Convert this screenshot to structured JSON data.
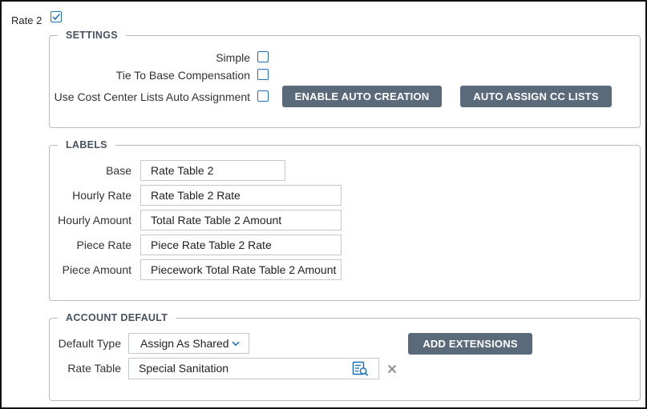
{
  "rate": {
    "label": "Rate 2",
    "enabled": true
  },
  "settings": {
    "title": "SETTINGS",
    "simple_label": "Simple",
    "tie_label": "Tie To Base Compensation",
    "cost_center_label": "Use Cost Center Lists Auto Assignment",
    "enable_button": "ENABLE AUTO CREATION",
    "assign_button": "AUTO ASSIGN CC LISTS"
  },
  "labels": {
    "title": "LABELS",
    "base_label": "Base",
    "base_value": "Rate Table 2",
    "hourly_rate_label": "Hourly Rate",
    "hourly_rate_value": "Rate Table 2 Rate",
    "hourly_amount_label": "Hourly Amount",
    "hourly_amount_value": "Total Rate Table 2 Amount",
    "piece_rate_label": "Piece Rate",
    "piece_rate_value": "Piece Rate Table 2 Rate",
    "piece_amount_label": "Piece Amount",
    "piece_amount_value": "Piecework Total Rate Table 2 Amount"
  },
  "account": {
    "title": "ACCOUNT DEFAULT",
    "default_type_label": "Default Type",
    "default_type_value": "Assign As Shared",
    "rate_table_label": "Rate Table",
    "rate_table_value": "Special Sanitation",
    "add_extensions_button": "ADD EXTENSIONS"
  },
  "icons": {
    "checkmark": "checkmark-icon",
    "dropdown": "chevron-down-icon",
    "lookup": "search-list-icon",
    "clear": "close-icon"
  },
  "colors": {
    "accent": "#1a73b8",
    "button": "#5b6a7b",
    "legend": "#475260",
    "border": "#b5bcc4"
  }
}
